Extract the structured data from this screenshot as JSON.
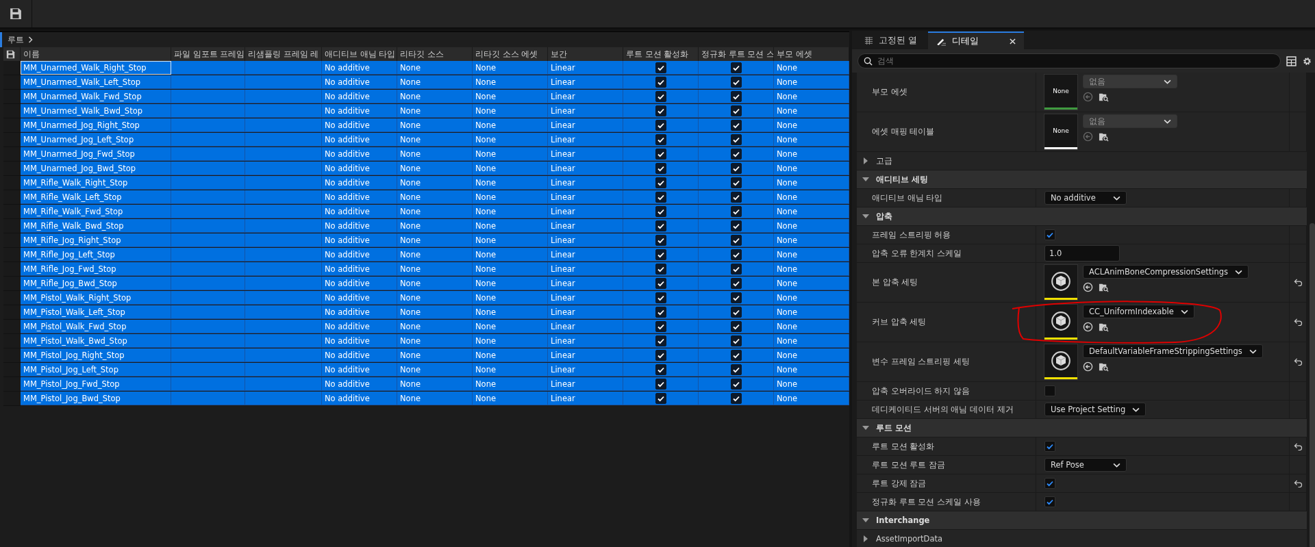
{
  "breadcrumb": {
    "label": "루트"
  },
  "table": {
    "columns": [
      "이름",
      "파일 임포트 프레임",
      "리샘플링 프레임 레",
      "애디티브 애님 타입",
      "리타깃 소스",
      "리타깃 소스 에셋",
      "보간",
      "루트 모션 활성화",
      "정규화 루트 모션 스",
      "부모 에셋"
    ],
    "rows": [
      {
        "name": "MM_Unarmed_Walk_Right_Stop",
        "additive_type": "No additive",
        "retarget_source": "None",
        "retarget_source_asset": "None",
        "interpolation": "Linear",
        "root_motion": true,
        "normalize": true,
        "parent_asset": "None",
        "selected": true,
        "focused": true
      },
      {
        "name": "MM_Unarmed_Walk_Left_Stop",
        "additive_type": "No additive",
        "retarget_source": "None",
        "retarget_source_asset": "None",
        "interpolation": "Linear",
        "root_motion": true,
        "normalize": true,
        "parent_asset": "None",
        "selected": true,
        "focused": false
      },
      {
        "name": "MM_Unarmed_Walk_Fwd_Stop",
        "additive_type": "No additive",
        "retarget_source": "None",
        "retarget_source_asset": "None",
        "interpolation": "Linear",
        "root_motion": true,
        "normalize": true,
        "parent_asset": "None",
        "selected": true,
        "focused": false
      },
      {
        "name": "MM_Unarmed_Walk_Bwd_Stop",
        "additive_type": "No additive",
        "retarget_source": "None",
        "retarget_source_asset": "None",
        "interpolation": "Linear",
        "root_motion": true,
        "normalize": true,
        "parent_asset": "None",
        "selected": true,
        "focused": false
      },
      {
        "name": "MM_Unarmed_Jog_Right_Stop",
        "additive_type": "No additive",
        "retarget_source": "None",
        "retarget_source_asset": "None",
        "interpolation": "Linear",
        "root_motion": true,
        "normalize": true,
        "parent_asset": "None",
        "selected": true,
        "focused": false
      },
      {
        "name": "MM_Unarmed_Jog_Left_Stop",
        "additive_type": "No additive",
        "retarget_source": "None",
        "retarget_source_asset": "None",
        "interpolation": "Linear",
        "root_motion": true,
        "normalize": true,
        "parent_asset": "None",
        "selected": true,
        "focused": false
      },
      {
        "name": "MM_Unarmed_Jog_Fwd_Stop",
        "additive_type": "No additive",
        "retarget_source": "None",
        "retarget_source_asset": "None",
        "interpolation": "Linear",
        "root_motion": true,
        "normalize": true,
        "parent_asset": "None",
        "selected": true,
        "focused": false
      },
      {
        "name": "MM_Unarmed_Jog_Bwd_Stop",
        "additive_type": "No additive",
        "retarget_source": "None",
        "retarget_source_asset": "None",
        "interpolation": "Linear",
        "root_motion": true,
        "normalize": true,
        "parent_asset": "None",
        "selected": true,
        "focused": false
      },
      {
        "name": "MM_Rifle_Walk_Right_Stop",
        "additive_type": "No additive",
        "retarget_source": "None",
        "retarget_source_asset": "None",
        "interpolation": "Linear",
        "root_motion": true,
        "normalize": true,
        "parent_asset": "None",
        "selected": true,
        "focused": false
      },
      {
        "name": "MM_Rifle_Walk_Left_Stop",
        "additive_type": "No additive",
        "retarget_source": "None",
        "retarget_source_asset": "None",
        "interpolation": "Linear",
        "root_motion": true,
        "normalize": true,
        "parent_asset": "None",
        "selected": true,
        "focused": false
      },
      {
        "name": "MM_Rifle_Walk_Fwd_Stop",
        "additive_type": "No additive",
        "retarget_source": "None",
        "retarget_source_asset": "None",
        "interpolation": "Linear",
        "root_motion": true,
        "normalize": true,
        "parent_asset": "None",
        "selected": true,
        "focused": false
      },
      {
        "name": "MM_Rifle_Walk_Bwd_Stop",
        "additive_type": "No additive",
        "retarget_source": "None",
        "retarget_source_asset": "None",
        "interpolation": "Linear",
        "root_motion": true,
        "normalize": true,
        "parent_asset": "None",
        "selected": true,
        "focused": false
      },
      {
        "name": "MM_Rifle_Jog_Right_Stop",
        "additive_type": "No additive",
        "retarget_source": "None",
        "retarget_source_asset": "None",
        "interpolation": "Linear",
        "root_motion": true,
        "normalize": true,
        "parent_asset": "None",
        "selected": true,
        "focused": false
      },
      {
        "name": "MM_Rifle_Jog_Left_Stop",
        "additive_type": "No additive",
        "retarget_source": "None",
        "retarget_source_asset": "None",
        "interpolation": "Linear",
        "root_motion": true,
        "normalize": true,
        "parent_asset": "None",
        "selected": true,
        "focused": false
      },
      {
        "name": "MM_Rifle_Jog_Fwd_Stop",
        "additive_type": "No additive",
        "retarget_source": "None",
        "retarget_source_asset": "None",
        "interpolation": "Linear",
        "root_motion": true,
        "normalize": true,
        "parent_asset": "None",
        "selected": true,
        "focused": false
      },
      {
        "name": "MM_Rifle_Jog_Bwd_Stop",
        "additive_type": "No additive",
        "retarget_source": "None",
        "retarget_source_asset": "None",
        "interpolation": "Linear",
        "root_motion": true,
        "normalize": true,
        "parent_asset": "None",
        "selected": true,
        "focused": false
      },
      {
        "name": "MM_Pistol_Walk_Right_Stop",
        "additive_type": "No additive",
        "retarget_source": "None",
        "retarget_source_asset": "None",
        "interpolation": "Linear",
        "root_motion": true,
        "normalize": true,
        "parent_asset": "None",
        "selected": true,
        "focused": false
      },
      {
        "name": "MM_Pistol_Walk_Left_Stop",
        "additive_type": "No additive",
        "retarget_source": "None",
        "retarget_source_asset": "None",
        "interpolation": "Linear",
        "root_motion": true,
        "normalize": true,
        "parent_asset": "None",
        "selected": true,
        "focused": false
      },
      {
        "name": "MM_Pistol_Walk_Fwd_Stop",
        "additive_type": "No additive",
        "retarget_source": "None",
        "retarget_source_asset": "None",
        "interpolation": "Linear",
        "root_motion": true,
        "normalize": true,
        "parent_asset": "None",
        "selected": true,
        "focused": false
      },
      {
        "name": "MM_Pistol_Walk_Bwd_Stop",
        "additive_type": "No additive",
        "retarget_source": "None",
        "retarget_source_asset": "None",
        "interpolation": "Linear",
        "root_motion": true,
        "normalize": true,
        "parent_asset": "None",
        "selected": true,
        "focused": false
      },
      {
        "name": "MM_Pistol_Jog_Right_Stop",
        "additive_type": "No additive",
        "retarget_source": "None",
        "retarget_source_asset": "None",
        "interpolation": "Linear",
        "root_motion": true,
        "normalize": true,
        "parent_asset": "None",
        "selected": true,
        "focused": false
      },
      {
        "name": "MM_Pistol_Jog_Left_Stop",
        "additive_type": "No additive",
        "retarget_source": "None",
        "retarget_source_asset": "None",
        "interpolation": "Linear",
        "root_motion": true,
        "normalize": true,
        "parent_asset": "None",
        "selected": true,
        "focused": false
      },
      {
        "name": "MM_Pistol_Jog_Fwd_Stop",
        "additive_type": "No additive",
        "retarget_source": "None",
        "retarget_source_asset": "None",
        "interpolation": "Linear",
        "root_motion": true,
        "normalize": true,
        "parent_asset": "None",
        "selected": true,
        "focused": false
      },
      {
        "name": "MM_Pistol_Jog_Bwd_Stop",
        "additive_type": "No additive",
        "retarget_source": "None",
        "retarget_source_asset": "None",
        "interpolation": "Linear",
        "root_motion": true,
        "normalize": true,
        "parent_asset": "None",
        "selected": true,
        "focused": false
      }
    ]
  },
  "details": {
    "tabs": [
      {
        "label": "고정된 열",
        "kind": "columns",
        "selected": false
      },
      {
        "label": "디테일",
        "kind": "details",
        "selected": true
      }
    ],
    "search": {
      "placeholder": "검색"
    },
    "properties": [
      {
        "kind": "asset",
        "label": "부모 에셋",
        "thumb_label": "None",
        "value": "없음",
        "disabled": true,
        "color": "#3f9a3f",
        "reset": false
      },
      {
        "kind": "asset",
        "label": "에셋 매핑 테이블",
        "thumb_label": "None",
        "value": "없음",
        "disabled": true,
        "color": "#ffffff",
        "reset": false
      },
      {
        "kind": "subcategory",
        "label": "고급",
        "expanded": false
      },
      {
        "kind": "category",
        "label": "애디티브 세팅",
        "expanded": true
      },
      {
        "kind": "combo",
        "label": "애디티브 애님 타입",
        "value": "No additive",
        "reset": false
      },
      {
        "kind": "category",
        "label": "압축",
        "expanded": true
      },
      {
        "kind": "checkbox",
        "label": "프레임 스트리핑 허용",
        "checked": true,
        "reset": false
      },
      {
        "kind": "text",
        "label": "압축 오류 한계치 스케일",
        "value": "1.0",
        "reset": false
      },
      {
        "kind": "asset",
        "label": "본 압축 세팅",
        "value": "ACLAnimBoneCompressionSettings",
        "disabled": false,
        "color": "#f0e000",
        "reset": true
      },
      {
        "kind": "asset",
        "label": "커브 압축 세팅",
        "value": "CC_UniformIndexable",
        "disabled": false,
        "color": "#f0e000",
        "reset": true
      },
      {
        "kind": "asset",
        "label": "변수 프레임 스트리핑 세팅",
        "value": "DefaultVariableFrameStrippingSettings",
        "disabled": false,
        "color": "#f0e000",
        "reset": true
      },
      {
        "kind": "checkbox",
        "label": "압축 오버라이드 하지 않음",
        "checked": false,
        "reset": false
      },
      {
        "kind": "combo",
        "label": "데디케이티드 서버의 애님 데이터 제거",
        "value": "Use Project Setting",
        "reset": false
      },
      {
        "kind": "category",
        "label": "루트 모션",
        "expanded": true
      },
      {
        "kind": "checkbox",
        "label": "루트 모션 활성화",
        "checked": true,
        "reset": true
      },
      {
        "kind": "combo",
        "label": "루트 모션 루트 잠금",
        "value": "Ref Pose",
        "reset": false
      },
      {
        "kind": "checkbox",
        "label": "루트 강제 잠금",
        "checked": true,
        "reset": true
      },
      {
        "kind": "checkbox",
        "label": "정규화 루트 모션 스케일 사용",
        "checked": true,
        "reset": false
      },
      {
        "kind": "category",
        "label": "Interchange",
        "expanded": true
      },
      {
        "kind": "subcategory",
        "label": "AssetImportData",
        "expanded": false
      }
    ]
  }
}
